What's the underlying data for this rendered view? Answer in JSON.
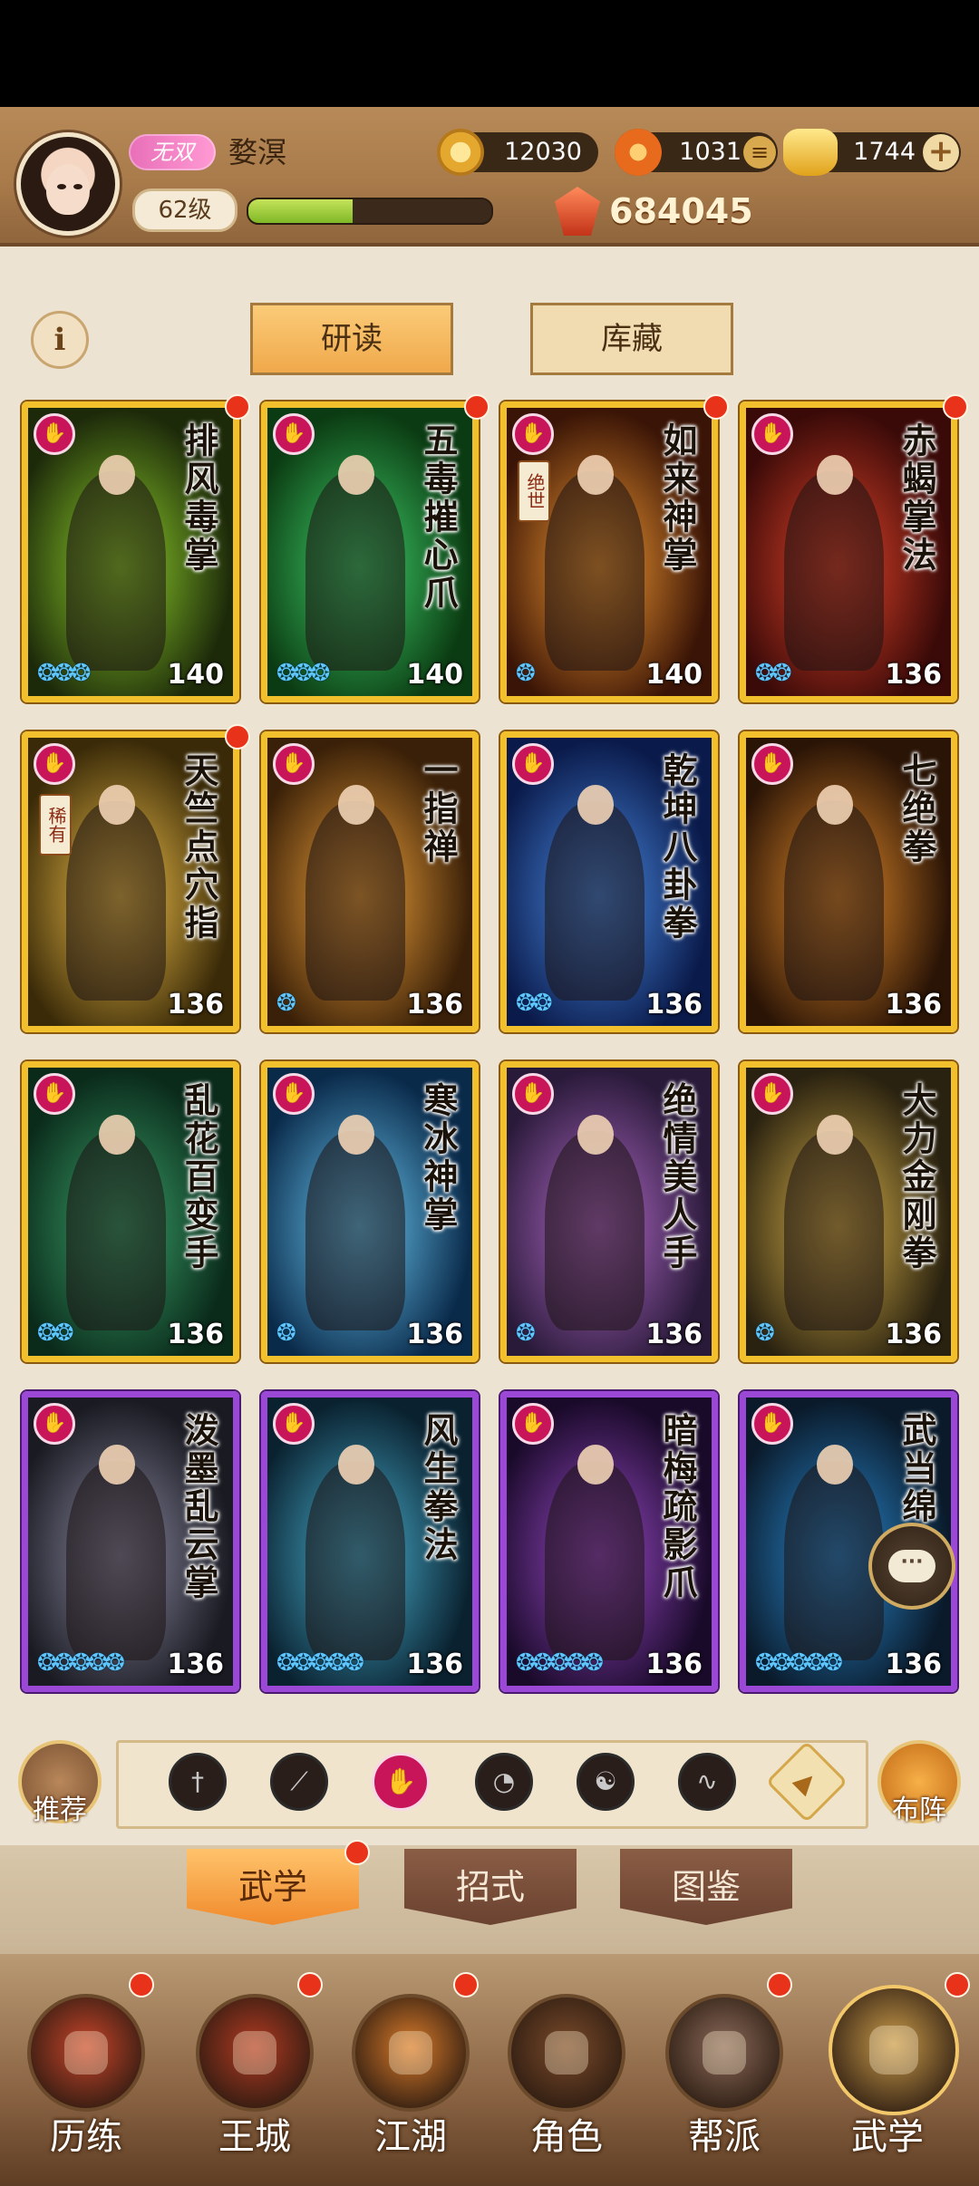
{
  "player": {
    "vip_label": "无双",
    "name": "婺溟",
    "level": "62级",
    "exp_fraction": 0.43
  },
  "resources": {
    "coins": "12030",
    "spirit": "1031",
    "gold": "1744",
    "power": "684045"
  },
  "top_buttons": {
    "study": "研读",
    "collection": "库藏"
  },
  "cards": [
    {
      "name": "排风毒掌",
      "level": "140",
      "stars": 3,
      "frame": "gold",
      "dot": true,
      "grade": ""
    },
    {
      "name": "五毒摧心爪",
      "level": "140",
      "stars": 3,
      "frame": "gold",
      "dot": true,
      "grade": ""
    },
    {
      "name": "如来神掌",
      "level": "140",
      "stars": 1,
      "frame": "gold",
      "dot": true,
      "grade": "绝世"
    },
    {
      "name": "赤蝎掌法",
      "level": "136",
      "stars": 2,
      "frame": "gold",
      "dot": true,
      "grade": ""
    },
    {
      "name": "天竺点穴指",
      "level": "136",
      "stars": 0,
      "frame": "gold",
      "dot": true,
      "grade": "稀有"
    },
    {
      "name": "一指禅",
      "level": "136",
      "stars": 1,
      "frame": "gold",
      "dot": false,
      "grade": ""
    },
    {
      "name": "乾坤八卦拳",
      "level": "136",
      "stars": 2,
      "frame": "gold",
      "dot": false,
      "grade": ""
    },
    {
      "name": "七绝拳",
      "level": "136",
      "stars": 0,
      "frame": "gold",
      "dot": false,
      "grade": ""
    },
    {
      "name": "乱花百变手",
      "level": "136",
      "stars": 2,
      "frame": "gold",
      "dot": false,
      "grade": ""
    },
    {
      "name": "寒冰神掌",
      "level": "136",
      "stars": 1,
      "frame": "gold",
      "dot": false,
      "grade": ""
    },
    {
      "name": "绝情美人手",
      "level": "136",
      "stars": 1,
      "frame": "gold",
      "dot": false,
      "grade": ""
    },
    {
      "name": "大力金刚拳",
      "level": "136",
      "stars": 1,
      "frame": "gold",
      "dot": false,
      "grade": ""
    },
    {
      "name": "泼墨乱云掌",
      "level": "136",
      "stars": 5,
      "frame": "purple",
      "dot": false,
      "grade": ""
    },
    {
      "name": "风生拳法",
      "level": "136",
      "stars": 5,
      "frame": "purple",
      "dot": false,
      "grade": ""
    },
    {
      "name": "暗梅疏影爪",
      "level": "136",
      "stars": 5,
      "frame": "purple",
      "dot": false,
      "grade": ""
    },
    {
      "name": "武当绵",
      "level": "136",
      "stars": 5,
      "frame": "purple",
      "dot": false,
      "grade": ""
    }
  ],
  "card_art_colors": [
    [
      "#1d2a0a",
      "#8fd12a"
    ],
    [
      "#0b3b12",
      "#3fd16a"
    ],
    [
      "#3a1406",
      "#f39a32"
    ],
    [
      "#3a0a08",
      "#e2432a"
    ],
    [
      "#3a2a08",
      "#f2c24a"
    ],
    [
      "#3a2008",
      "#f0a23a"
    ],
    [
      "#0a1a4a",
      "#4a8ae2"
    ],
    [
      "#2a1406",
      "#e28a2a"
    ],
    [
      "#0a2a1a",
      "#3aa26a"
    ],
    [
      "#0a2a4a",
      "#6ac8f2"
    ],
    [
      "#2a1a3a",
      "#b26ac8"
    ],
    [
      "#2a2210",
      "#d9b24a"
    ],
    [
      "#1a1a22",
      "#8a8aa2"
    ],
    [
      "#0a2230",
      "#4ab2d2"
    ],
    [
      "#1a0a2a",
      "#9a4ac8"
    ],
    [
      "#0a1a2a",
      "#2a8ad2"
    ]
  ],
  "recommend_label": "推荐",
  "formation_label": "布阵",
  "filter_icons": [
    "sword-icon",
    "blade-icon",
    "palm-icon",
    "fan-icon",
    "yin-yang-icon",
    "whip-icon",
    "up-arrow-icon"
  ],
  "subtabs": {
    "martial": "武学",
    "moves": "招式",
    "atlas": "图鉴"
  },
  "nav": [
    {
      "label": "历练",
      "dot": true,
      "color": "#c8442a"
    },
    {
      "label": "王城",
      "dot": true,
      "color": "#b23a22"
    },
    {
      "label": "江湖",
      "dot": true,
      "color": "#d87a2a"
    },
    {
      "label": "角色",
      "dot": false,
      "color": "#7a4a2a"
    },
    {
      "label": "帮派",
      "dot": true,
      "color": "#8a6a5a"
    },
    {
      "label": "武学",
      "dot": true,
      "color": "#c89a4a"
    }
  ]
}
